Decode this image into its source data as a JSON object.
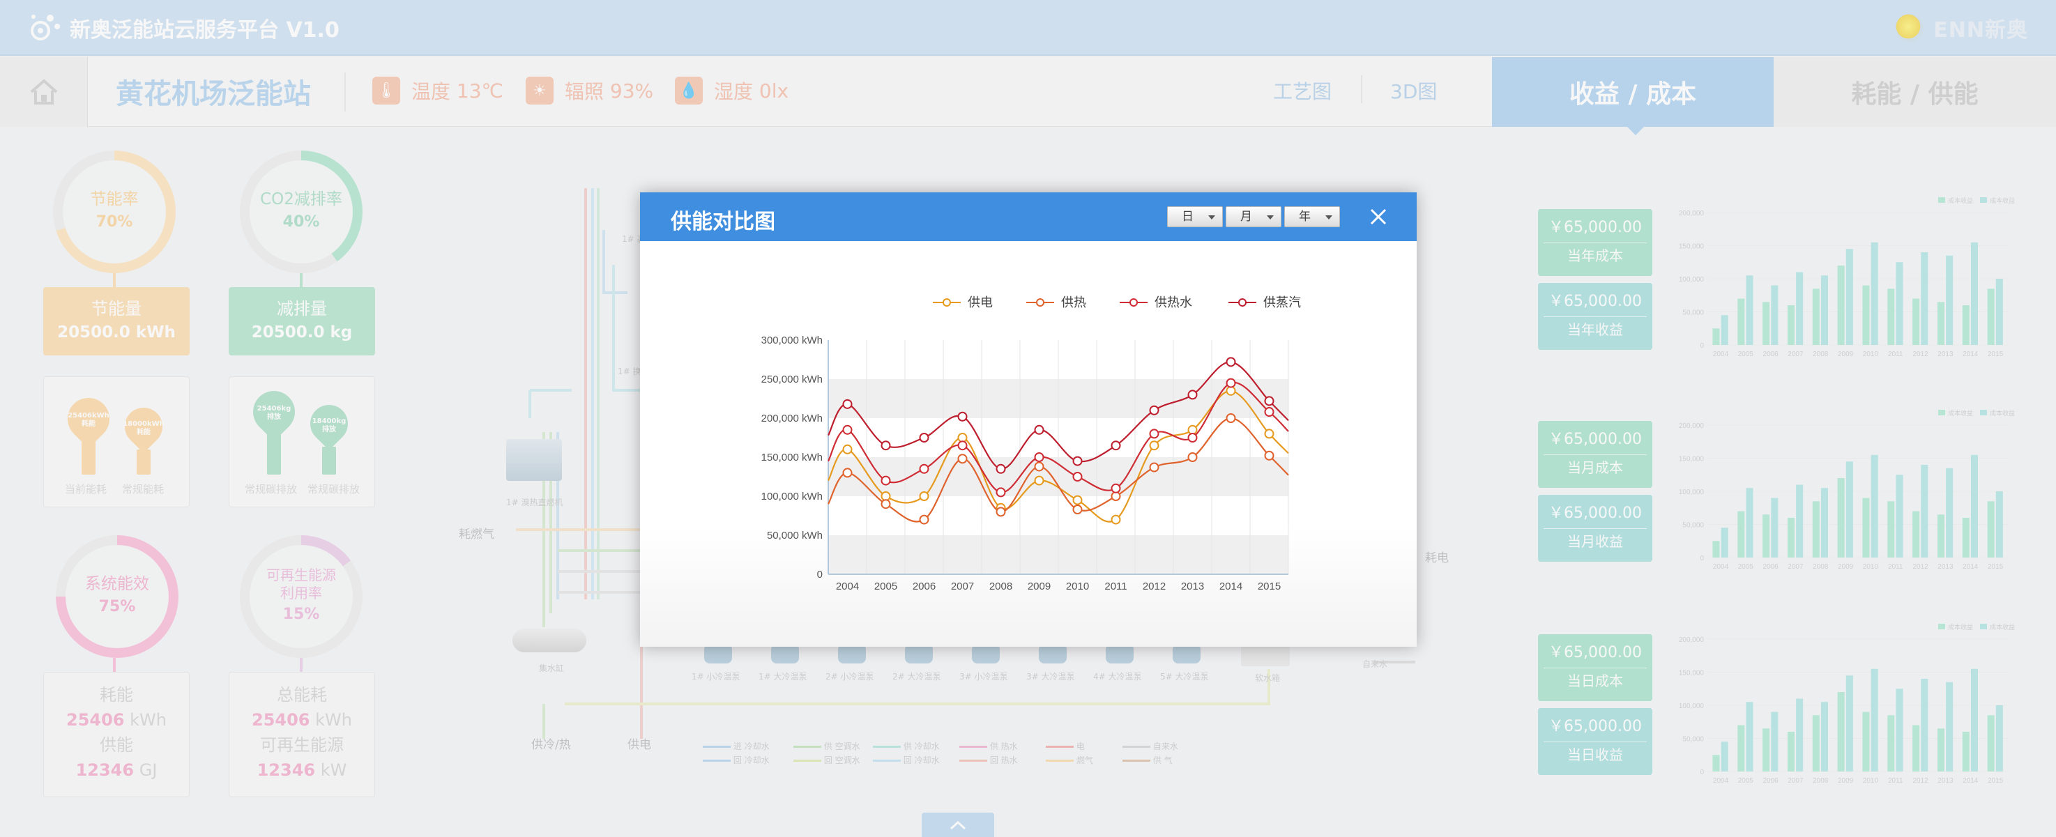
{
  "app": {
    "title": "新奥泛能站云服务平台 V1.0",
    "brand": "ENN新奥"
  },
  "subheader": {
    "station_name": "黄花机场泛能站",
    "weather": [
      {
        "label": "温度",
        "value": "13℃",
        "icon": "thermometer-icon"
      },
      {
        "label": "辐照",
        "value": "93%",
        "icon": "sun-icon"
      },
      {
        "label": "湿度",
        "value": "0lx",
        "icon": "droplet-icon"
      }
    ],
    "links": [
      "工艺图",
      "3D图"
    ],
    "tabs": [
      {
        "label": "收益 / 成本",
        "active": true
      },
      {
        "label": "耗能 / 供能",
        "active": false
      }
    ]
  },
  "left": {
    "gauges": [
      {
        "label": "节能率",
        "value": "70%",
        "percent": 70,
        "color": "#fde0b4"
      },
      {
        "label": "CO2减排率",
        "value": "40%",
        "percent": 40,
        "color": "#a6e2c8"
      },
      {
        "label": "系统能效",
        "value": "75%",
        "percent": 75,
        "color": "#f8b4d3"
      },
      {
        "label_line1": "可再生能源",
        "label_line2": "利用率",
        "value": "15%",
        "percent": 15,
        "color": "#e8c8e7"
      }
    ],
    "metric_boxes": [
      {
        "label": "节能量",
        "value": "20500.0 kWh",
        "color": "#fbd8a8"
      },
      {
        "label": "减排量",
        "value": "20500.0 kg",
        "color": "#a9e1c5"
      }
    ],
    "pin_cards": [
      {
        "pins": [
          {
            "text": "25406kWh",
            "sub": "耗能"
          },
          {
            "text": "18000kWh",
            "sub": "耗能"
          }
        ],
        "captions": [
          "当前能耗",
          "常规能耗"
        ],
        "color": "#fbd39a"
      },
      {
        "pins": [
          {
            "text": "25406kg",
            "sub": "排放"
          },
          {
            "text": "18400kg",
            "sub": "排放"
          }
        ],
        "captions": [
          "常规碳排放",
          "常规碳排放"
        ],
        "color": "#a2dcc0"
      }
    ],
    "stat_cards": [
      {
        "l1": "耗能",
        "v1": "25406",
        "u1": "kWh",
        "l2": "供能",
        "v2": "12346",
        "u2": "GJ"
      },
      {
        "l1": "总能耗",
        "v1": "25406",
        "u1": "kWh",
        "l2": "可再生能源",
        "v2": "12346",
        "u2": "kW"
      }
    ]
  },
  "diagram": {
    "labels": {
      "fuel_gas": "耗燃气",
      "power_out": "耗电",
      "supply_cool_heat": "供冷/热",
      "supply_power": "供电",
      "tap_water": "自来水",
      "chiller": "1# 溴热直燃机",
      "hx1": "1# 高",
      "hx2": "1# 换热",
      "tank": "集水缸",
      "water_tank": "软水箱"
    },
    "pumps": [
      "1# 小冷温泵",
      "1# 大冷温泵",
      "2# 小冷温泵",
      "2# 大冷温泵",
      "3# 小冷温泵",
      "3# 大冷温泵",
      "4# 大冷温泵",
      "5# 大冷温泵"
    ],
    "legend": [
      "进 冷却水",
      "回 冷却水",
      "供 空调水",
      "回 空调水",
      "供 冷却水",
      "回 冷却水",
      "供 热水",
      "回 热水",
      "电",
      "燃气",
      "自来水",
      "供 气"
    ]
  },
  "right": {
    "groups": [
      {
        "cost_value": "￥65,000.00",
        "cost_label": "当年成本",
        "income_value": "￥65,000.00",
        "income_label": "当年收益"
      },
      {
        "cost_value": "￥65,000.00",
        "cost_label": "当月成本",
        "income_value": "￥65,000.00",
        "income_label": "当月收益"
      },
      {
        "cost_value": "￥65,000.00",
        "cost_label": "当日成本",
        "income_value": "￥65,000.00",
        "income_label": "当日收益"
      }
    ],
    "mini_chart": {
      "legend": [
        "成本收益",
        "成本收益"
      ],
      "years": [
        "2004",
        "2005",
        "2006",
        "2007",
        "2008",
        "2009",
        "2010",
        "2011",
        "2012",
        "2013",
        "2014",
        "2015"
      ],
      "yticks": [
        "200,000",
        "150,000",
        "100,000",
        "50,000",
        "0"
      ],
      "ymax": 200000,
      "s1": [
        25000,
        70000,
        65000,
        60000,
        85000,
        120000,
        90000,
        85000,
        70000,
        65000,
        60000,
        85000
      ],
      "s2": [
        45000,
        105000,
        90000,
        110000,
        105000,
        145000,
        155000,
        125000,
        140000,
        135000,
        155000,
        100000
      ],
      "colors": [
        "#a6e7cf",
        "#a7e2e1"
      ]
    }
  },
  "modal": {
    "title": "供能对比图",
    "selects": [
      "日",
      "月",
      "年"
    ],
    "close_icon": "close-icon"
  },
  "chart_data": {
    "type": "line",
    "title": "供能对比图",
    "x": [
      "2004",
      "2005",
      "2006",
      "2007",
      "2008",
      "2009",
      "2010",
      "2011",
      "2012",
      "2013",
      "2014",
      "2015"
    ],
    "y_ticks": [
      "300,000 kWh",
      "250,000 kWh",
      "200,000 kWh",
      "150,000 kWh",
      "100,000 kWh",
      "50,000 kWh",
      "0"
    ],
    "ylim": [
      0,
      300000
    ],
    "legend_position": "top",
    "series": [
      {
        "name": "供电",
        "color": "#e69a1e",
        "values": [
          160000,
          100000,
          100000,
          175000,
          85000,
          120000,
          95000,
          70000,
          165000,
          185000,
          235000,
          180000
        ]
      },
      {
        "name": "供热",
        "color": "#e0622c",
        "values": [
          130000,
          90000,
          70000,
          148000,
          80000,
          138000,
          83000,
          100000,
          137000,
          150000,
          200000,
          152000
        ]
      },
      {
        "name": "供热水",
        "color": "#cf2c34",
        "values": [
          185000,
          120000,
          135000,
          165000,
          105000,
          150000,
          125000,
          110000,
          180000,
          175000,
          245000,
          208000
        ]
      },
      {
        "name": "供蒸汽",
        "color": "#be1e2d",
        "values": [
          218000,
          165000,
          175000,
          202000,
          135000,
          185000,
          145000,
          165000,
          210000,
          230000,
          272000,
          222000
        ]
      }
    ]
  }
}
